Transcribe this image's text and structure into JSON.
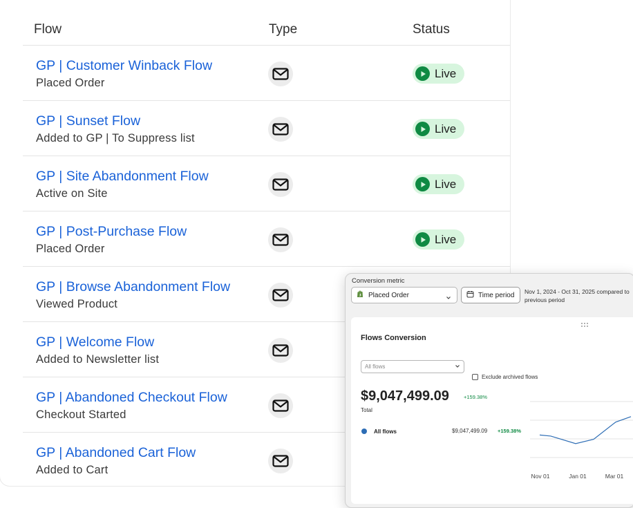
{
  "table": {
    "headers": {
      "flow": "Flow",
      "type": "Type",
      "status": "Status"
    },
    "rows": [
      {
        "name": "GP | Customer Winback Flow",
        "trigger": "Placed Order",
        "type_icon": "email-icon",
        "status": "Live"
      },
      {
        "name": "GP | Sunset Flow",
        "trigger": "Added to GP | To Suppress list",
        "type_icon": "email-icon",
        "status": "Live"
      },
      {
        "name": "GP | Site Abandonment Flow",
        "trigger": "Active on Site",
        "type_icon": "email-icon",
        "status": "Live"
      },
      {
        "name": "GP | Post-Purchase Flow",
        "trigger": "Placed Order",
        "type_icon": "email-icon",
        "status": "Live"
      },
      {
        "name": "GP | Browse Abandonment Flow",
        "trigger": "Viewed Product",
        "type_icon": "email-icon",
        "status": ""
      },
      {
        "name": "GP | Welcome Flow",
        "trigger": "Added to Newsletter list",
        "type_icon": "email-icon",
        "status": ""
      },
      {
        "name": "GP | Abandoned Checkout Flow",
        "trigger": "Checkout Started",
        "type_icon": "email-icon",
        "status": ""
      },
      {
        "name": "GP | Abandoned Cart Flow",
        "trigger": "Added to Cart",
        "type_icon": "email-icon",
        "status": ""
      }
    ]
  },
  "report": {
    "conversion_metric_label": "Conversion metric",
    "metric_value": "Placed Order",
    "metric_icon": "shopify-icon",
    "time_period_label": "Time period",
    "date_range": "Nov 1, 2024 - Oct 31, 2025 compared to previous period",
    "card_title": "Flows Conversion",
    "flows_filter_placeholder": "All flows",
    "exclude_archived_label": "Exclude archived flows",
    "total_value": "$9,047,499.09",
    "total_change": "+159.38%",
    "total_label": "Total",
    "series_row": {
      "name": "All flows",
      "value": "$9,047,499.09",
      "change": "+159.38%"
    }
  },
  "colors": {
    "link": "#1a62d8",
    "live_badge_bg": "#d7f5de",
    "live_dot": "#0f8a43",
    "positive": "#0f8a43",
    "series_line": "#2d6db5"
  },
  "chart_data": {
    "type": "line",
    "x_tick_labels": [
      "Nov 01",
      "Jan 01",
      "Mar 01"
    ],
    "grid": true,
    "legend": "none",
    "series": [
      {
        "name": "All flows",
        "values": [
          0.38,
          0.36,
          0.22,
          0.3,
          0.62,
          0.72
        ]
      }
    ]
  }
}
